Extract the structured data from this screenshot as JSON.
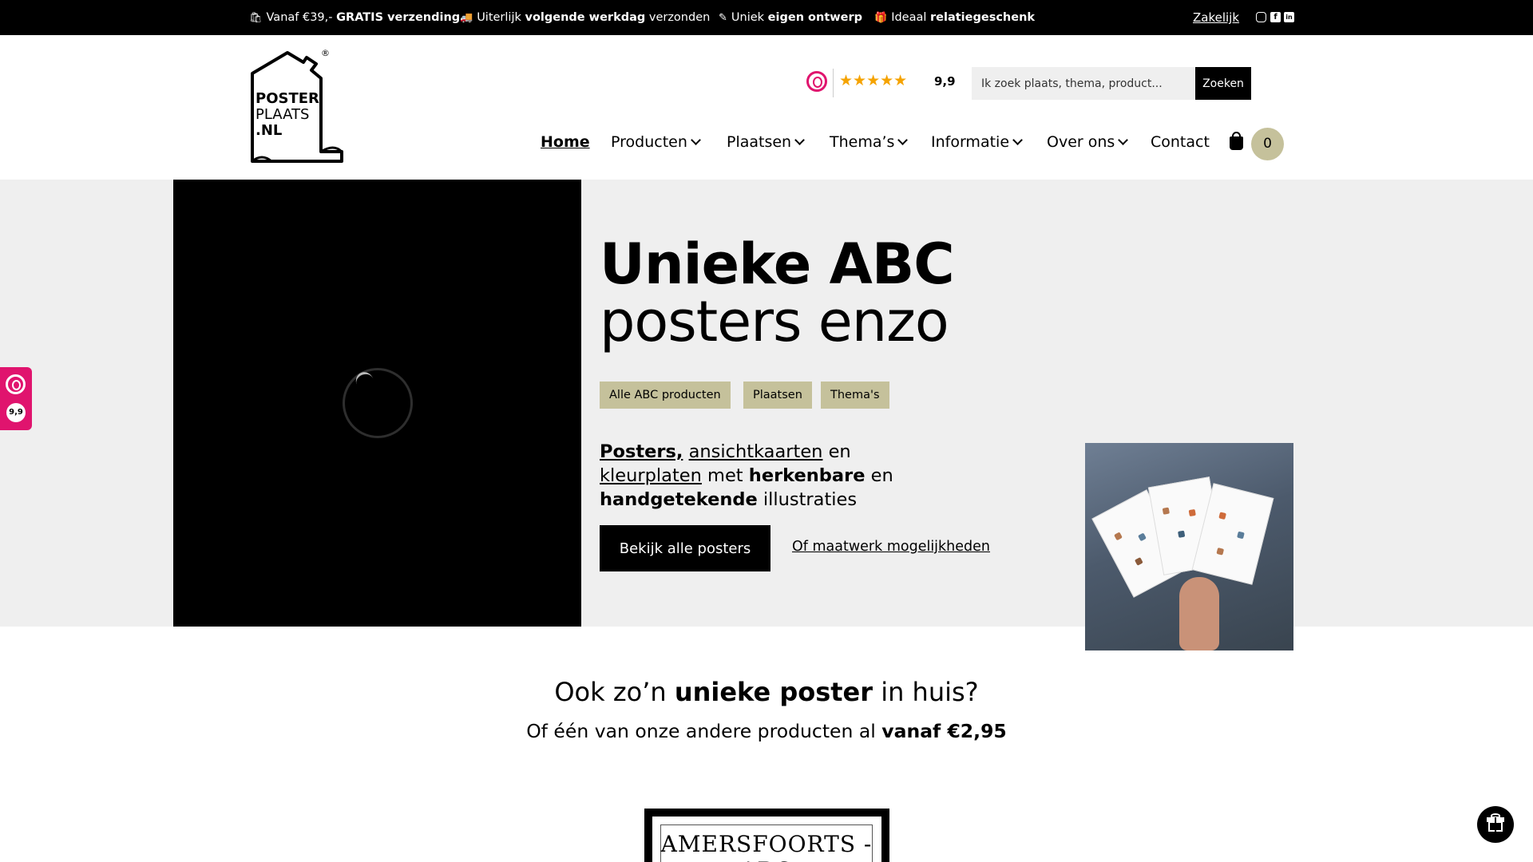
{
  "topbar": {
    "usps": [
      {
        "icon": "bag-icon",
        "glyph": "🛍",
        "pre": "Vanaf €39,-",
        "bold": "GRATIS verzending",
        "post": ""
      },
      {
        "icon": "truck-icon",
        "glyph": "🚚",
        "pre": "Uiterlijk",
        "bold": "volgende werkdag",
        "post": "verzonden"
      },
      {
        "icon": "pencil-icon",
        "glyph": "✎",
        "pre": "Uniek",
        "bold": "eigen ontwerp",
        "post": ""
      },
      {
        "icon": "gift-icon",
        "glyph": "🎁",
        "pre": "Ideaal",
        "bold": "relatiegeschenk",
        "post": ""
      }
    ],
    "zakelijk": "Zakelijk",
    "social": [
      "instagram-icon",
      "facebook-icon",
      "linkedin-icon"
    ]
  },
  "header": {
    "logo": {
      "line1": "POSTER",
      "line2": "PLAATS",
      "line3": ".NL",
      "registered": "®"
    },
    "rating": {
      "stars": "★★★★★",
      "score": "9,9",
      "brand_color": "#e0146e"
    },
    "search": {
      "placeholder": "Ik zoek plaats, thema, product...",
      "button": "Zoeken"
    },
    "nav": [
      {
        "label": "Home",
        "active": true,
        "dropdown": false
      },
      {
        "label": "Producten",
        "active": false,
        "dropdown": true
      },
      {
        "label": "Plaatsen",
        "active": false,
        "dropdown": true
      },
      {
        "label": "Thema’s",
        "active": false,
        "dropdown": true
      },
      {
        "label": "Informatie",
        "active": false,
        "dropdown": true
      },
      {
        "label": "Over ons",
        "active": false,
        "dropdown": true
      },
      {
        "label": "Contact",
        "active": false,
        "dropdown": false
      }
    ],
    "cart_count": "0"
  },
  "hero": {
    "title_bold": "Unieke ABC",
    "title_light": "posters enzo",
    "tags": [
      "Alle ABC producten",
      "Plaatsen",
      "Thema's"
    ],
    "text": {
      "posters": "Posters,",
      "ansichtkaarten": "ansichtkaarten",
      "en1": "en",
      "kleurplaten": "kleurplaten",
      "met": "met",
      "herkenbare": "herkenbare",
      "en2": "en",
      "handgetekende": "handgetekende",
      "illustraties": "illustraties"
    },
    "cta": "Bekijk alle posters",
    "cta_link": "Of maatwerk mogelijkheden",
    "accent_color": "#c5c19b"
  },
  "side_widget": {
    "score": "9,9"
  },
  "section": {
    "title_pre": "Ook zo’n",
    "title_bold": "unieke poster",
    "title_post": "in huis?",
    "sub_pre": "Of één van onze andere  producten al",
    "sub_bold": "vanaf €2,95",
    "poster_title": "AMERSFOORTS - ABC"
  }
}
